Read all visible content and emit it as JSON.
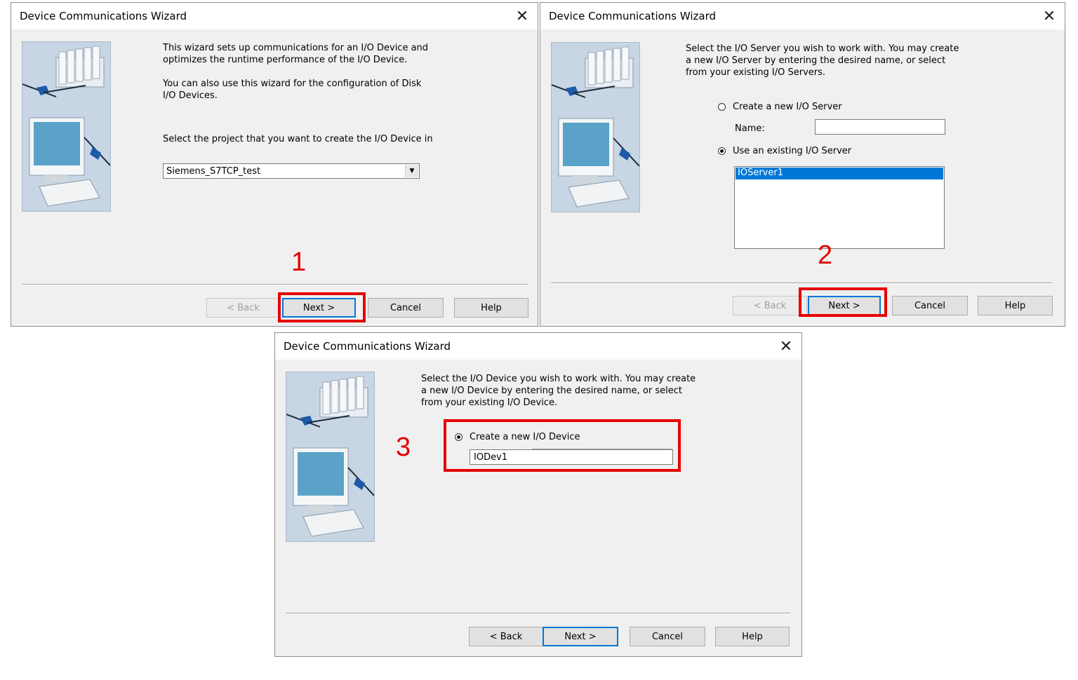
{
  "colors": {
    "highlight": "#e60000",
    "selection": "#0078d7",
    "dialog_bg": "#f0f0f0"
  },
  "dialog1": {
    "title": "Device Communications Wizard",
    "intro_line1": "This wizard sets up communications for an I/O Device and",
    "intro_line2": "optimizes the runtime performance of the I/O Device.",
    "intro_line3": "You can also use this wizard for the configuration of Disk",
    "intro_line4": "I/O Devices.",
    "select_prompt": "Select the project that you want to create the I/O Device in",
    "project_value": "Siemens_S7TCP_test",
    "step_number": "1",
    "buttons": {
      "back": "< Back",
      "next": "Next >",
      "cancel": "Cancel",
      "help": "Help"
    }
  },
  "dialog2": {
    "title": "Device Communications Wizard",
    "intro_line1": "Select the I/O Server you wish to work with. You may create",
    "intro_line2": "a new I/O Server by entering the desired name, or select",
    "intro_line3": "from your existing I/O Servers.",
    "radio_new": "Create a new I/O Server",
    "name_label": "Name:",
    "name_value": "",
    "radio_existing": "Use an existing I/O Server",
    "servers": [
      "IOServer1"
    ],
    "step_number": "2",
    "buttons": {
      "back": "< Back",
      "next": "Next >",
      "cancel": "Cancel",
      "help": "Help"
    }
  },
  "dialog3": {
    "title": "Device Communications Wizard",
    "intro_line1": "Select the I/O Device you wish to work with. You may create",
    "intro_line2": "a new I/O Device by entering the desired name, or select",
    "intro_line3": "from your existing I/O Device.",
    "radio_new": "Create a new I/O Device",
    "device_value": "IODev1",
    "step_number": "3",
    "buttons": {
      "back": "< Back",
      "next": "Next >",
      "cancel": "Cancel",
      "help": "Help"
    }
  }
}
